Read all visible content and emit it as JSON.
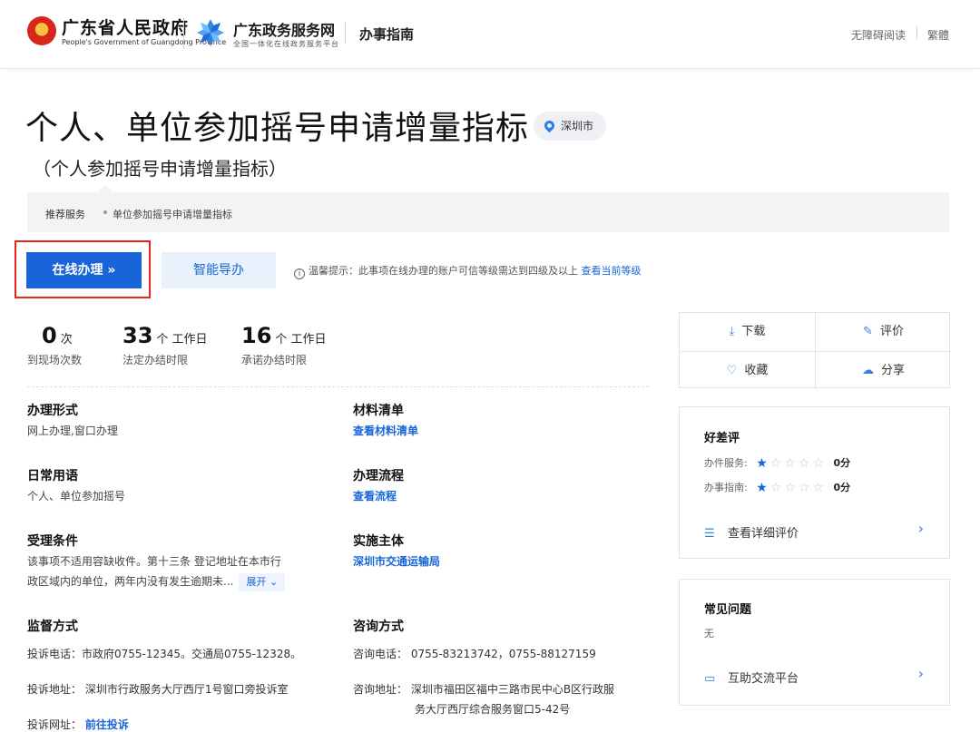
{
  "header": {
    "gov_name": "广东省人民政府",
    "gov_en": "People's Government of Guangdong Province",
    "portal_name": "广东政务服务网",
    "portal_sub": "全国一体化在线政务服务平台",
    "section_title": "办事指南",
    "accessibility": "无障碍阅读",
    "traditional": "繁體"
  },
  "title": {
    "main": "个人、单位参加摇号申请增量指标",
    "city": "深圳市",
    "sub": "（个人参加摇号申请增量指标）"
  },
  "recommend": {
    "label": "推荐服务",
    "item": "单位参加摇号申请增量指标"
  },
  "actions": {
    "online": "在线办理 »",
    "smart_guide": "智能导办",
    "tip_prefix": "温馨提示：此事项在线办理的账户可信等级需达到四级及以上",
    "tip_link": "查看当前等级"
  },
  "stats": [
    {
      "num": "0",
      "unit": "次",
      "label": "到现场次数"
    },
    {
      "num": "33",
      "unit": "个 工作日",
      "label": "法定办结时限"
    },
    {
      "num": "16",
      "unit": "个 工作日",
      "label": "承诺办结时限"
    }
  ],
  "fields": {
    "form_title": "办理形式",
    "form_value": "网上办理,窗口办理",
    "materials_title": "材料清单",
    "materials_link": "查看材料清单",
    "common_title": "日常用语",
    "common_value": "个人、单位参加摇号",
    "process_title": "办理流程",
    "process_link": "查看流程",
    "condition_title": "受理条件",
    "condition_line1": "该事项不适用容缺收件。第十三条   登记地址在本市行",
    "condition_line2": "政区域内的单位，两年内没有发生逾期未...",
    "expand": "展开 ⌄",
    "subject_title": "实施主体",
    "subject_link": "深圳市交通运输局",
    "supervise_title": "监督方式",
    "consult_title": "咨询方式"
  },
  "supervise": {
    "phone": "投诉电话：市政府0755-12345。交通局0755-12328。",
    "address": "投诉地址：  深圳市行政服务大厅西厅1号窗口旁投诉室",
    "web_label": "投诉网址：",
    "web_link": "前往投诉"
  },
  "consult": {
    "phone": "咨询电话：  0755-83213742，0755-88127159",
    "address1": "咨询地址：  深圳市福田区福中三路市民中心B区行政服",
    "address2": "务大厅西厅综合服务窗口5-42号"
  },
  "side_actions": {
    "download": "下载",
    "evaluate": "评价",
    "favorite": "收藏",
    "share": "分享"
  },
  "rating": {
    "title": "好差评",
    "service_label": "办件服务:",
    "service_score": "0分",
    "guide_label": "办事指南:",
    "guide_score": "0分",
    "stars_filled": 1,
    "stars_total": 5,
    "detail_link": "查看详细评价"
  },
  "faq": {
    "title": "常见问题",
    "value": "无",
    "platform_link": "互助交流平台"
  }
}
